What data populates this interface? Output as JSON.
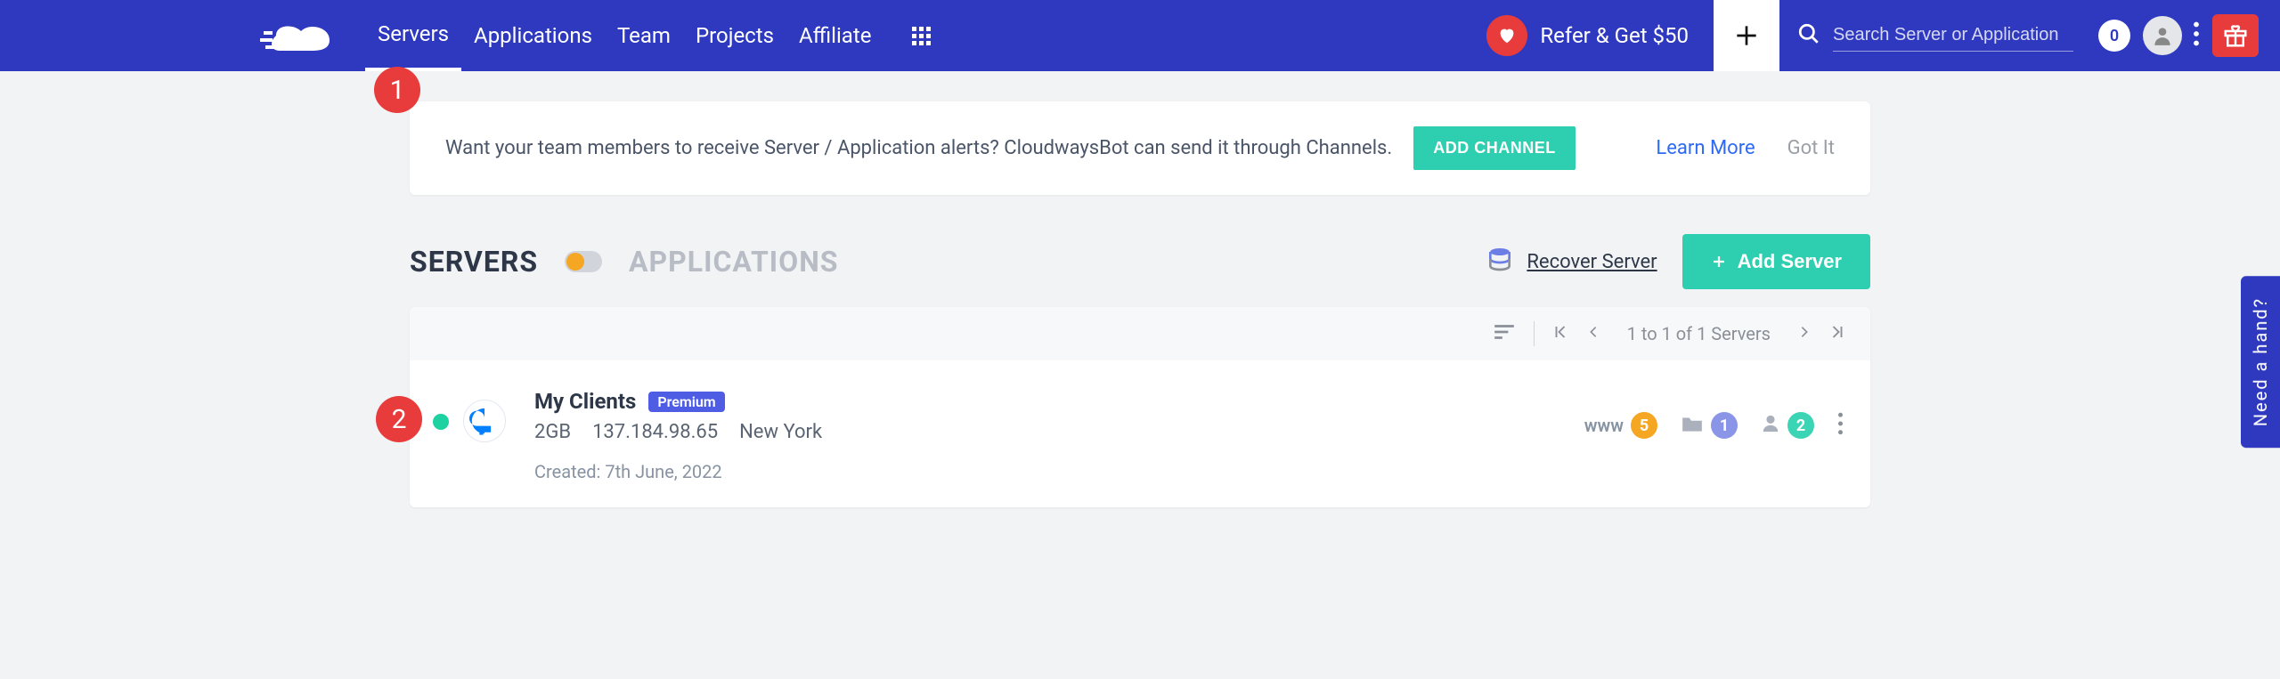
{
  "nav": {
    "links": [
      "Servers",
      "Applications",
      "Team",
      "Projects",
      "Affiliate"
    ],
    "refer_label": "Refer & Get $50",
    "search_placeholder": "Search Server or Application",
    "notif_count": "0"
  },
  "banner": {
    "text": "Want your team members to receive Server / Application alerts? CloudwaysBot can send it through Channels.",
    "add_channel_label": "ADD CHANNEL",
    "learn_more_label": "Learn More",
    "got_it_label": "Got It"
  },
  "section": {
    "tab_servers": "SERVERS",
    "tab_applications": "APPLICATIONS",
    "recover_label": "Recover Server",
    "add_server_label": "Add Server"
  },
  "pagination": {
    "text": "1 to 1 of 1 Servers"
  },
  "server": {
    "name": "My Clients",
    "badge": "Premium",
    "size": "2GB",
    "ip": "137.184.98.65",
    "region": "New York",
    "created": "Created: 7th June, 2022",
    "stats": {
      "www_label": "www",
      "www_count": "5",
      "folder_count": "1",
      "users_count": "2"
    }
  },
  "help_tab": "Need a hand?",
  "callouts": {
    "one": "1",
    "two": "2"
  }
}
